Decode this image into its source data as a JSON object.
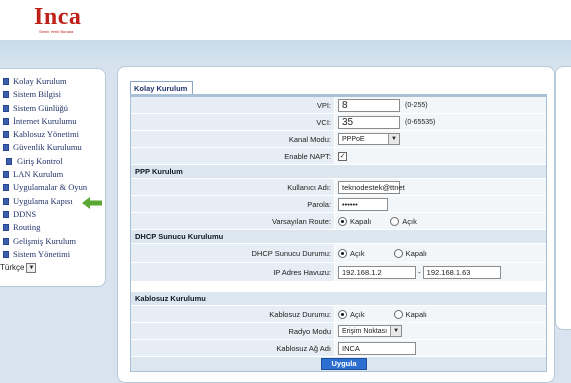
{
  "brand": {
    "logo": "Inca",
    "tagline": "Senin Yerin Burada"
  },
  "sidebar": {
    "items": [
      {
        "label": "Kolay Kurulum"
      },
      {
        "label": "Sistem Bilgisi"
      },
      {
        "label": "Sistem Günlüğü"
      },
      {
        "label": "İnternet Kurulumu"
      },
      {
        "label": "Kablosuz Yönetimi"
      },
      {
        "label": "Güvenlik Kurulumu"
      },
      {
        "label": "Giriş Kontrol"
      },
      {
        "label": "LAN Kurulum"
      },
      {
        "label": "Uygulamalar & Oyun"
      },
      {
        "label": "Uygulama Kapısı"
      },
      {
        "label": "DDNS"
      },
      {
        "label": "Routing"
      },
      {
        "label": "Gelişmiş Kurulum"
      },
      {
        "label": "Sistem Yönetimi"
      }
    ],
    "language": "Türkçe"
  },
  "main": {
    "tab": "Kolay Kurulum",
    "vpi": {
      "label": "VPI:",
      "value": "8",
      "hint": "(0-255)"
    },
    "vci": {
      "label": "VCI:",
      "value": "35",
      "hint": "(0-65535)"
    },
    "channel_mode": {
      "label": "Kanal Modu:",
      "value": "PPPoE"
    },
    "napt": {
      "label": "Enable NAPT:",
      "checked": true
    },
    "ppp": {
      "section": "PPP Kurulum",
      "username": {
        "label": "Kullanıcı Adı:",
        "value": "teknodestek@ttnet"
      },
      "password": {
        "label": "Parola:",
        "value": "••••••"
      },
      "default_route": {
        "label": "Varsayılan Route:",
        "options": [
          "Kapalı",
          "Açık"
        ],
        "selected": "Kapalı"
      }
    },
    "dhcp": {
      "section": "DHCP Sunucu Kurulumu",
      "server_status": {
        "label": "DHCP Sunucu Durumu:",
        "options": [
          "Açık",
          "Kapalı"
        ],
        "selected": "Açık"
      },
      "ip_pool": {
        "label": "IP Adres Havuzu:",
        "start": "192.168.1.2",
        "separator": "-",
        "end": "192.168.1.63"
      }
    },
    "wireless": {
      "section": "Kablosuz Kurulumu",
      "status": {
        "label": "Kablosuz Durumu:",
        "options": [
          "Açık",
          "Kapalı"
        ],
        "selected": "Açık"
      },
      "radio_mode": {
        "label": "Radyo Modu",
        "value": "Erişim Noktası"
      },
      "network_name": {
        "label": "Kablosuz Ağ Adı",
        "value": "INCA"
      }
    },
    "apply_label": "Uygula"
  },
  "colors": {
    "brand_red": "#c0201a",
    "nav_text": "#23346a",
    "apply_blue": "#2d6fd0",
    "arrow_green": "#5aa832"
  },
  "icons": {
    "pointer_arrow": "left-arrow-icon",
    "nav_bullet": "square-bullet-icon"
  }
}
